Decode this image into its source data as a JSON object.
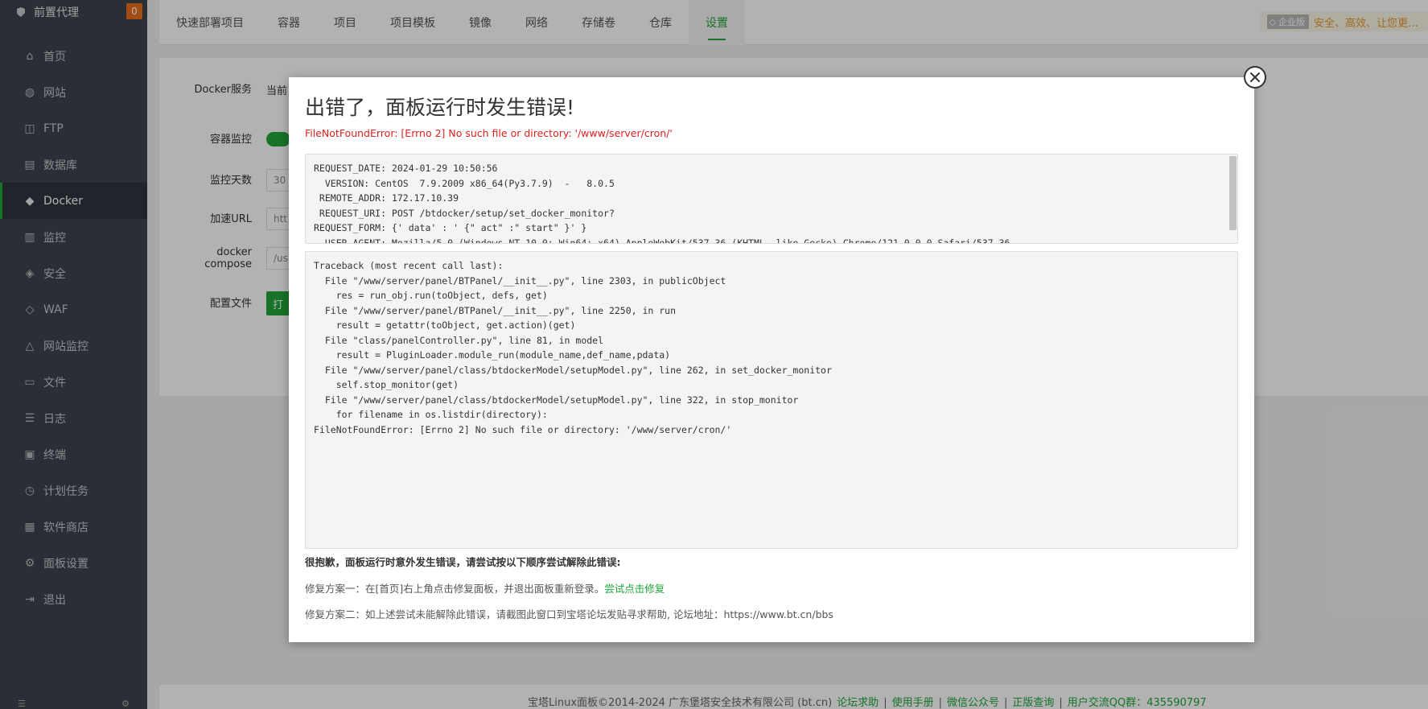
{
  "sidebar": {
    "brand": "前置代理",
    "badge": "0",
    "items": [
      {
        "label": "首页",
        "icon": "home-icon"
      },
      {
        "label": "网站",
        "icon": "globe-icon"
      },
      {
        "label": "FTP",
        "icon": "ftp-icon"
      },
      {
        "label": "数据库",
        "icon": "database-icon"
      },
      {
        "label": "Docker",
        "icon": "docker-icon"
      },
      {
        "label": "监控",
        "icon": "monitor-icon"
      },
      {
        "label": "安全",
        "icon": "shield-icon"
      },
      {
        "label": "WAF",
        "icon": "waf-shield-icon"
      },
      {
        "label": "网站监控",
        "icon": "chart-icon"
      },
      {
        "label": "文件",
        "icon": "folder-icon"
      },
      {
        "label": "日志",
        "icon": "log-icon"
      },
      {
        "label": "终端",
        "icon": "terminal-icon"
      },
      {
        "label": "计划任务",
        "icon": "clock-icon"
      },
      {
        "label": "软件商店",
        "icon": "grid-icon"
      },
      {
        "label": "面板设置",
        "icon": "gear-icon"
      },
      {
        "label": "退出",
        "icon": "logout-icon"
      }
    ]
  },
  "tabs": [
    "快速部署项目",
    "容器",
    "项目",
    "项目模板",
    "镜像",
    "网络",
    "存储卷",
    "仓库",
    "设置"
  ],
  "enterprise": {
    "tag": "企业版",
    "text": "安全、高效、让您更…"
  },
  "settings": {
    "docker_service_label": "Docker服务",
    "docker_service_value": "当前",
    "container_monitor_label": "容器监控",
    "monitor_days_label": "监控天数",
    "monitor_days_value": "30",
    "accel_url_label": "加速URL",
    "accel_url_placeholder": "htt",
    "compose_label_1": "docker",
    "compose_label_2": "compose",
    "compose_value": "/us",
    "config_label": "配置文件",
    "config_button": "打"
  },
  "modal": {
    "title": "出错了，面板运行时发生错误!",
    "error_line": "FileNotFoundError: [Errno 2] No such file or directory: '/www/server/cron/'",
    "request_info": "REQUEST_DATE: 2024-01-29 10:50:56\n  VERSION: CentOS  7.9.2009 x86_64(Py3.7.9)  -   8.0.5\n REMOTE_ADDR: 172.17.10.39\n REQUEST_URI: POST /btdocker/setup/set_docker_monitor?\nREQUEST_FORM: {' data' : ' {\" act\" :\" start\" }' }\n  USER_AGENT: Mozilla/5.0 (Windows NT 10.0; Win64; x64) AppleWebKit/537.36 (KHTML, like Gecko) Chrome/121.0.0.0 Safari/537.36",
    "traceback": "Traceback (most recent call last):\n  File \"/www/server/panel/BTPanel/__init__.py\", line 2303, in publicObject\n    res = run_obj.run(toObject, defs, get)\n  File \"/www/server/panel/BTPanel/__init__.py\", line 2250, in run\n    result = getattr(toObject, get.action)(get)\n  File \"class/panelController.py\", line 81, in model\n    result = PluginLoader.module_run(module_name,def_name,pdata)\n  File \"/www/server/panel/class/btdockerModel/setupModel.py\", line 262, in set_docker_monitor\n    self.stop_monitor(get)\n  File \"/www/server/panel/class/btdockerModel/setupModel.py\", line 322, in stop_monitor\n    for filename in os.listdir(directory):\nFileNotFoundError: [Errno 2] No such file or directory: '/www/server/cron/'",
    "hint": "很抱歉，面板运行时意外发生错误，请尝试按以下顺序尝试解除此错误:",
    "fix1_text": "修复方案一：在[首页]右上角点击修复面板，并退出面板重新登录。",
    "fix1_link": "尝试点击修复",
    "fix2_text": "修复方案二：如上述尝试未能解除此错误，请截图此窗口到宝塔论坛发贴寻求帮助, 论坛地址：https://www.bt.cn/bbs"
  },
  "footer": {
    "copyright": "宝塔Linux面板©2014-2024 广东堡塔安全技术有限公司 (bt.cn)",
    "links": [
      "论坛求助",
      "使用手册",
      "微信公众号",
      "正版查询",
      "用户交流QQ群：435590797"
    ]
  },
  "colors": {
    "accent": "#20a53a",
    "sidebar": "#3c444d",
    "error": "#e02020",
    "badge": "#e8701a"
  }
}
